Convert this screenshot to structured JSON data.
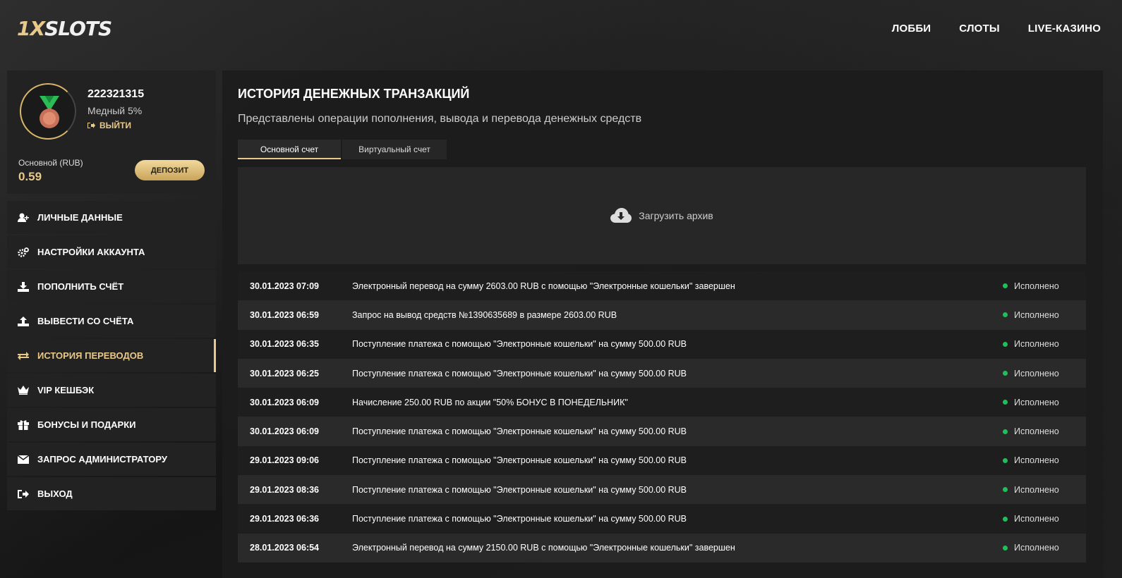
{
  "header": {
    "logo_prefix": "1X",
    "logo_suffix": "SLOTS",
    "nav": [
      {
        "label": "ЛОББИ"
      },
      {
        "label": "СЛОТЫ"
      },
      {
        "label": "LIVE-КАЗИНО"
      }
    ]
  },
  "profile": {
    "user_id": "222321315",
    "tier": "Медный 5%",
    "logout_label": "ВЫЙТИ",
    "balance_label": "Основной (RUB)",
    "balance_value": "0.59",
    "deposit_label": "ДЕПОЗИТ",
    "avatar_icon": "medal-icon"
  },
  "menu": [
    {
      "label": "ЛИЧНЫЕ ДАННЫЕ",
      "icon": "user-add-icon"
    },
    {
      "label": "НАСТРОЙКИ АККАУНТА",
      "icon": "gears-icon"
    },
    {
      "label": "ПОПОЛНИТЬ СЧЁТ",
      "icon": "download-icon"
    },
    {
      "label": "ВЫВЕСТИ СО СЧЁТА",
      "icon": "upload-icon"
    },
    {
      "label": "ИСТОРИЯ ПЕРЕВОДОВ",
      "icon": "transfer-icon",
      "active": true
    },
    {
      "label": "VIP КЕШБЭК",
      "icon": "crown-icon"
    },
    {
      "label": "БОНУСЫ И ПОДАРКИ",
      "icon": "gift-icon"
    },
    {
      "label": "ЗАПРОС АДМИНИСТРАТОРУ",
      "icon": "envelope-icon"
    },
    {
      "label": "ВЫХОД",
      "icon": "logout-icon"
    }
  ],
  "main": {
    "title": "ИСТОРИЯ ДЕНЕЖНЫХ ТРАНЗАКЦИЙ",
    "subtitle": "Представлены операции пополнения, вывода и перевода денежных средств",
    "tabs": [
      {
        "label": "Основной счет",
        "active": true
      },
      {
        "label": "Виртуальный счет"
      }
    ],
    "archive_label": "Загрузить архив",
    "transactions": [
      {
        "date": "30.01.2023 07:09",
        "desc": "Электронный перевод на сумму 2603.00 RUB с помощью \"Электронные кошельки\" завершен",
        "status": "Исполнено"
      },
      {
        "date": "30.01.2023 06:59",
        "desc": "Запрос на вывод средств №1390635689 в размере 2603.00 RUB",
        "status": "Исполнено"
      },
      {
        "date": "30.01.2023 06:35",
        "desc": "Поступление платежа с помощью \"Электронные кошельки\" на сумму 500.00 RUB",
        "status": "Исполнено"
      },
      {
        "date": "30.01.2023 06:25",
        "desc": "Поступление платежа с помощью \"Электронные кошельки\" на сумму 500.00 RUB",
        "status": "Исполнено"
      },
      {
        "date": "30.01.2023 06:09",
        "desc": "Начисление 250.00 RUB по акции \"50% БОНУС В ПОНЕДЕЛЬНИК\"",
        "status": "Исполнено"
      },
      {
        "date": "30.01.2023 06:09",
        "desc": "Поступление платежа с помощью \"Электронные кошельки\" на сумму 500.00 RUB",
        "status": "Исполнено"
      },
      {
        "date": "29.01.2023 09:06",
        "desc": "Поступление платежа с помощью \"Электронные кошельки\" на сумму 500.00 RUB",
        "status": "Исполнено"
      },
      {
        "date": "29.01.2023 08:36",
        "desc": "Поступление платежа с помощью \"Электронные кошельки\" на сумму 500.00 RUB",
        "status": "Исполнено"
      },
      {
        "date": "29.01.2023 06:36",
        "desc": "Поступление платежа с помощью \"Электронные кошельки\" на сумму 500.00 RUB",
        "status": "Исполнено"
      },
      {
        "date": "28.01.2023 06:54",
        "desc": "Электронный перевод на сумму 2150.00 RUB с помощью \"Электронные кошельки\" завершен",
        "status": "Исполнено"
      }
    ]
  },
  "colors": {
    "accent": "#e8c98a",
    "status_ok": "#1fbf5a",
    "panel": "#222222"
  }
}
